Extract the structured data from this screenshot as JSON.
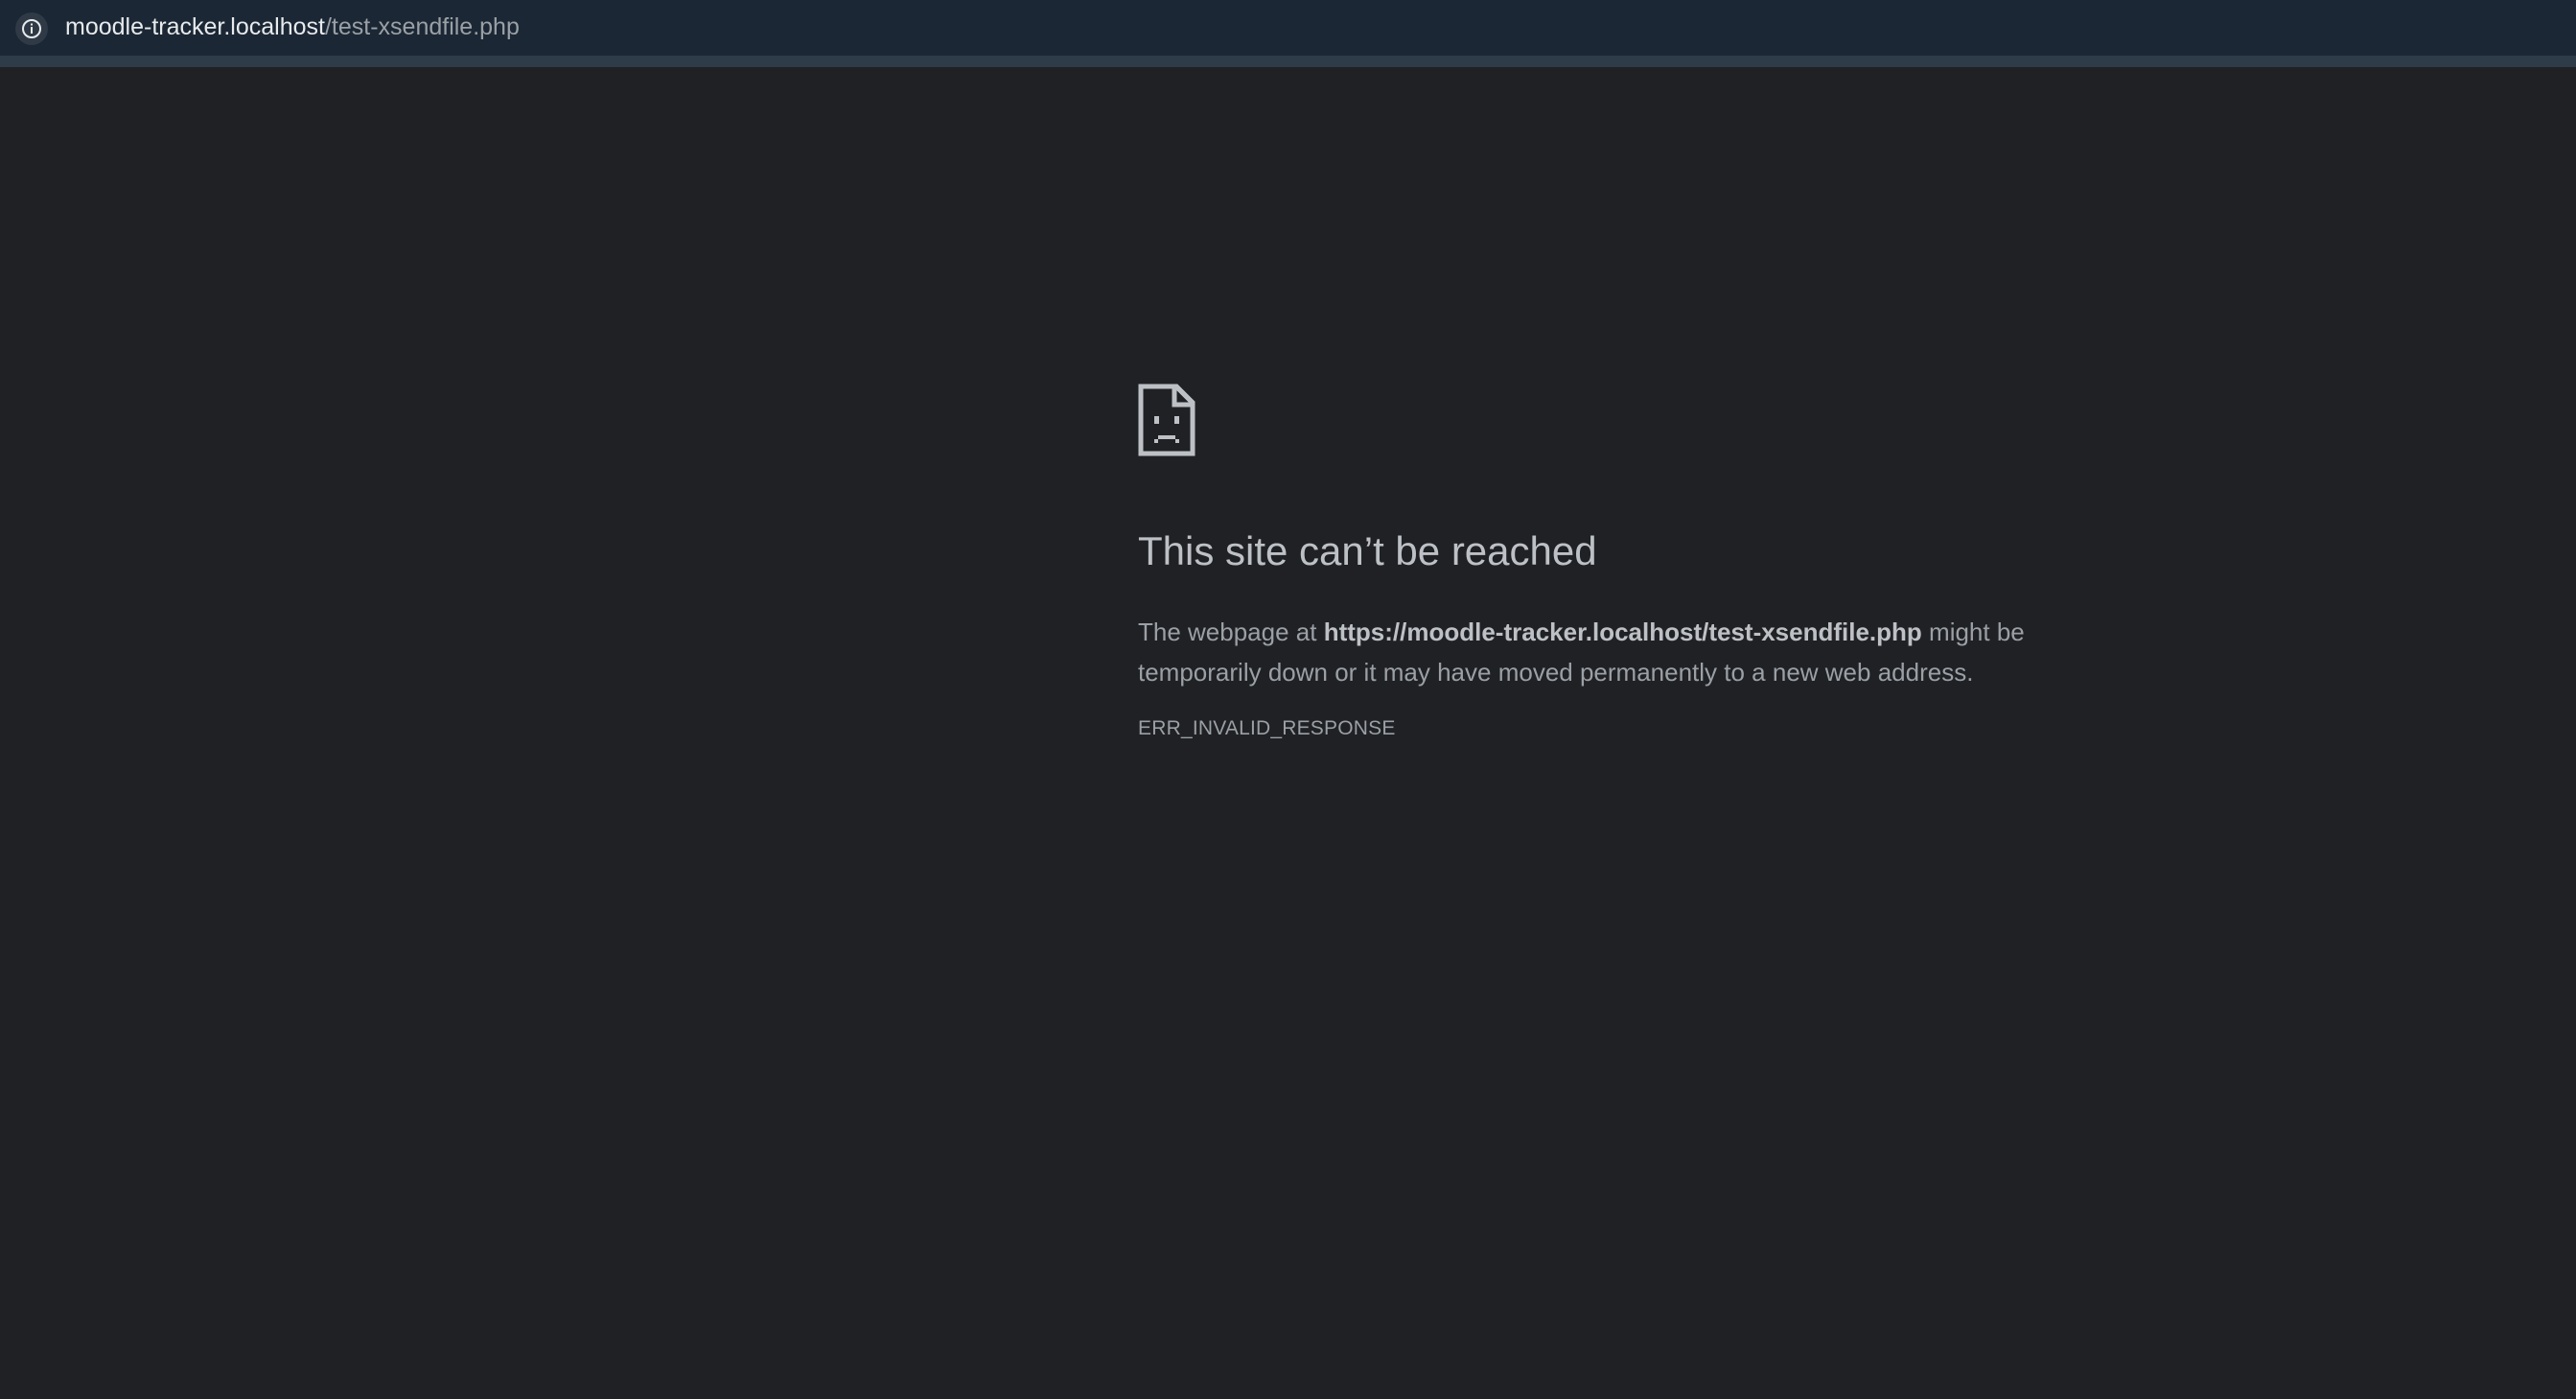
{
  "address_bar": {
    "icon": "info-icon",
    "url_host": "moodle-tracker.localhost",
    "url_path": "/test-xsendfile.php"
  },
  "error": {
    "icon": "sad-document-icon",
    "heading": "This site can’t be reached",
    "message_prefix": "The webpage at ",
    "message_url": "https://moodle-tracker.localhost/test-xsendfile.php",
    "message_suffix": " might be temporarily down or it may have moved permanently to a new web address.",
    "code": "ERR_INVALID_RESPONSE"
  },
  "colors": {
    "page_background": "#202124",
    "address_bar_background": "#1b2734",
    "heading_text": "#bdc1c6",
    "body_text": "#9aa0a6"
  }
}
